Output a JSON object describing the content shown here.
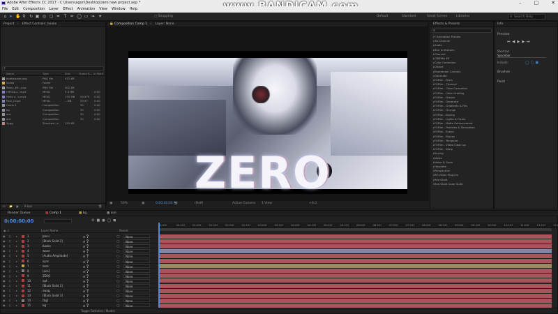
{
  "app": {
    "title": "Adobe After Effects CC 2017 - C:\\Users\\agon\\Desktop\\zero new project.aep *",
    "watermark": "www.BANDICAM.com"
  },
  "menu": [
    "File",
    "Edit",
    "Composition",
    "Layer",
    "Effect",
    "Animation",
    "View",
    "Window",
    "Help"
  ],
  "toolbar": {
    "snapping": "Snapping",
    "workspaces": [
      "Default",
      "Standard",
      "Small Screen",
      "Libraries"
    ],
    "search_placeholder": "Search Help"
  },
  "project": {
    "tab": "Project",
    "effect_controls": "Effect Controls: books",
    "columns": [
      "Name",
      "Type",
      "Size",
      "Frame R...",
      "In Point"
    ],
    "items": [
      {
        "name": "bookswave.png",
        "color": "#a0a0a0",
        "type": "PNG file",
        "size": "472 KB",
        "fr": "",
        "inp": ""
      },
      {
        "name": "Solids",
        "color": "#d4b040",
        "type": "Folder",
        "size": "",
        "fr": "",
        "inp": ""
      },
      {
        "name": "Remy_Kit...png",
        "color": "#a0a0a0",
        "type": "PNG file",
        "size": "402 KB",
        "fr": "",
        "inp": ""
      },
      {
        "name": "HSSOA.s...mp4",
        "color": "#8080c0",
        "type": "MPEG",
        "size": "5.4 MB",
        "fr": "",
        "inp": "0:00"
      },
      {
        "name": "Hello u...s.mp4",
        "color": "#8080c0",
        "type": "MPEG",
        "size": "170 MB",
        "fr": "29,970",
        "inp": "0:00"
      },
      {
        "name": "Pain_Lmp4",
        "color": "#8080c0",
        "type": "MPEG",
        "size": "...MB",
        "fr": "29,97",
        "inp": "0:00"
      },
      {
        "name": "Comp 1",
        "color": "#9090a0",
        "type": "Composition",
        "size": "",
        "fr": "30",
        "inp": "0:00"
      },
      {
        "name": "bg",
        "color": "#9090a0",
        "type": "Composition",
        "size": "",
        "fr": "30",
        "inp": "0:00"
      },
      {
        "name": "ace",
        "color": "#9090a0",
        "type": "Composition",
        "size": "",
        "fr": "30",
        "inp": "0:00"
      },
      {
        "name": "ace",
        "color": "#9090a0",
        "type": "Composition",
        "size": "",
        "fr": "30",
        "inp": "0:00"
      },
      {
        "name": "Xygg",
        "color": "#c08080",
        "type": "Shockwa...e",
        "size": "123 KB",
        "fr": "",
        "inp": ""
      }
    ],
    "footer": "8 bpc"
  },
  "comp": {
    "tab": "Composition Comp 1",
    "layer_tab": "Layer: None",
    "art_text": "ZERO",
    "footer": {
      "zoom": "50%",
      "time": "0;00;00;00",
      "res": "(Half)",
      "camera": "Active Camera",
      "view": "1 View",
      "exposure": "+0.0"
    }
  },
  "effects": {
    "title": "Effects & Presets",
    "items": [
      "* Animation Presets",
      "3D Channel",
      "Audio",
      "Blur & Sharpen",
      "Channel",
      "CINEMA 4D",
      "Color Correction",
      "Distort",
      "Expression Controls",
      "Generate",
      "FXFilm - Blurs",
      "FXFilm - Channel",
      "FXFilm - Color Correction",
      "FXFilm - Color Grading",
      "FXFilm - Distort",
      "FXFilm - Generate",
      "FXFilm - Gradients & Fills",
      "FXFilm - Grunge",
      "FXFilm - Keying",
      "FXFilm - Lights & Flares",
      "FXFilm - Matte Enhancement",
      "FXFilm - Particles & Simulation",
      "FXFilm - Scene",
      "FXFilm - Stylize",
      "FXFilm - Temporal",
      "FXFilm - Video Clean up",
      "FXFilm - Warp",
      "Keying",
      "Matte",
      "Noise & Grain",
      "Obsolete",
      "Perspective",
      "RE:Vision Plug-ins",
      "Red Giant",
      "Red Giant Color Suite"
    ]
  },
  "side": {
    "info": "Info",
    "preview": "Preview",
    "shortcut": "Shortcut",
    "shortcut_value": "Spacebar",
    "include": "Include:",
    "brushes": "Brushes",
    "paint": "Paint"
  },
  "timeline": {
    "render_queue": "Render Queue",
    "tabs": [
      "Comp 1",
      "bg",
      "ace"
    ],
    "timecode": "0;00;00;00",
    "col_layer": "Layer Name",
    "col_parent": "Parent",
    "ruler": [
      "0:00f",
      "00:15f",
      "01:00f",
      "01:15f",
      "02:00f",
      "02:15f",
      "03:00f",
      "03:15f",
      "04:00f",
      "04:15f",
      "05:00f",
      "05:15f",
      "06:00f",
      "06:15f",
      "07:00f",
      "07:15f",
      "08:00f",
      "08:15f",
      "09:00f",
      "09:15f",
      "10:00f",
      "10:15f",
      "11:00f",
      "11:15f",
      "12:0"
    ],
    "layers": [
      {
        "n": "1",
        "name": "Jeeni",
        "color": "#b04040",
        "parent": "None",
        "bar": "#a8545a"
      },
      {
        "n": "2",
        "name": "[Black Solid 2]",
        "color": "#b04040",
        "parent": "None",
        "bar": "#a8545a"
      },
      {
        "n": "3",
        "name": "books",
        "color": "#b04040",
        "parent": "None",
        "bar": "#a8545a"
      },
      {
        "n": "4",
        "name": "wave",
        "color": "#b04040",
        "parent": "None",
        "bar": "#7f86a8"
      },
      {
        "n": "5",
        "name": "[Audio Amplitude]",
        "color": "#b04040",
        "parent": "None",
        "bar": "#a8545a"
      },
      {
        "n": "6",
        "name": "sync",
        "color": "#b04040",
        "parent": "None",
        "bar": "#a8545a"
      },
      {
        "n": "7",
        "name": "zero",
        "color": "#c0a050",
        "parent": "None",
        "bar": "#9b8a60"
      },
      {
        "n": "8",
        "name": "[ace]",
        "color": "#808080",
        "parent": "None",
        "bar": "#a8545a"
      },
      {
        "n": "9",
        "name": "ZERO",
        "color": "#b04040",
        "parent": "None",
        "bar": "#a8545a"
      },
      {
        "n": "10",
        "name": "opt",
        "color": "#b04040",
        "parent": "None",
        "bar": "#a8545a"
      },
      {
        "n": "11",
        "name": "[Black Solid 1]",
        "color": "#b04040",
        "parent": "None",
        "bar": "#a8545a"
      },
      {
        "n": "12",
        "name": "swag",
        "color": "#b04040",
        "parent": "None",
        "bar": "#a8545a"
      },
      {
        "n": "13",
        "name": "[Black Solid 3]",
        "color": "#b04040",
        "parent": "None",
        "bar": "#a8545a"
      },
      {
        "n": "14",
        "name": "[bg]",
        "color": "#808080",
        "parent": "None",
        "bar": "#a8545a"
      },
      {
        "n": "15",
        "name": "bg",
        "color": "#b04040",
        "parent": "None",
        "bar": "#a8545a"
      }
    ],
    "footer": "Toggle Switches / Modes"
  }
}
